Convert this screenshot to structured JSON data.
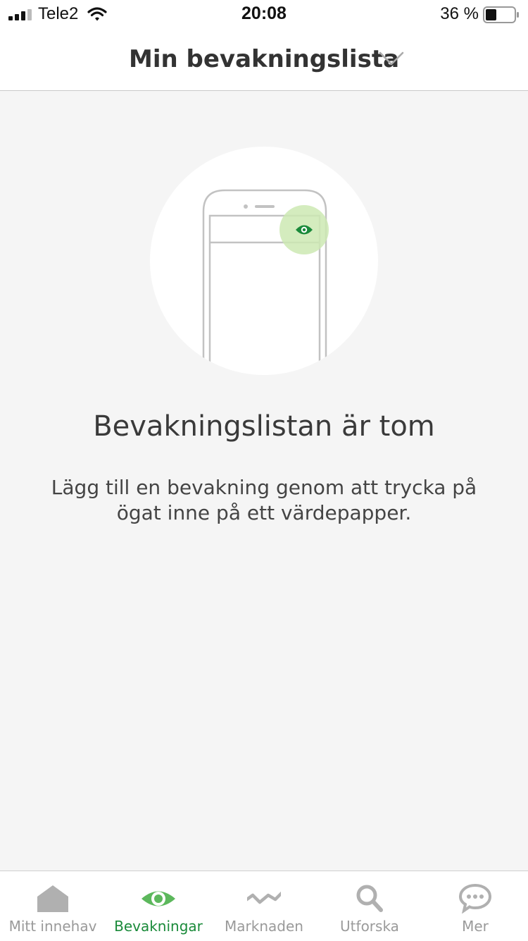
{
  "status_bar": {
    "carrier": "Tele2",
    "time": "20:08",
    "battery_percent": "36 %"
  },
  "header": {
    "title": "Min bevakningslista"
  },
  "empty_state": {
    "title": "Bevakningslistan är tom",
    "description": "Lägg till en bevakning genom att trycka på ögat inne på ett värdepapper."
  },
  "tab_bar": {
    "tabs": [
      {
        "label": "Mitt innehav",
        "icon": "house-icon",
        "active": false
      },
      {
        "label": "Bevakningar",
        "icon": "eye-icon",
        "active": true
      },
      {
        "label": "Marknaden",
        "icon": "trend-line-icon",
        "active": false
      },
      {
        "label": "Utforska",
        "icon": "search-icon",
        "active": false
      },
      {
        "label": "Mer",
        "icon": "chat-bubble-icon",
        "active": false
      }
    ]
  },
  "colors": {
    "accent_green": "#1a8a3a",
    "inactive_gray": "#9a9a9a",
    "background": "#f5f5f5"
  }
}
